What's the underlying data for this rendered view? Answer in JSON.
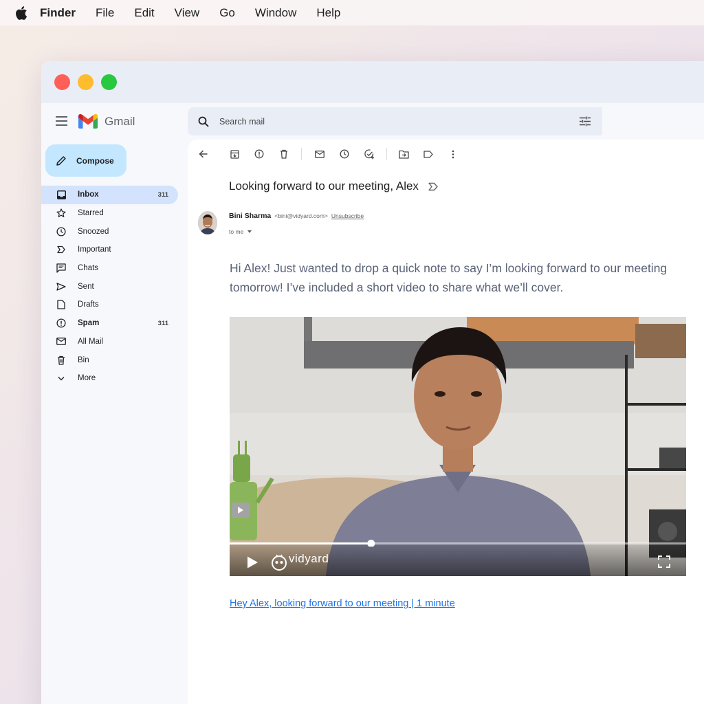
{
  "menubar": {
    "app": "Finder",
    "items": [
      "File",
      "Edit",
      "View",
      "Go",
      "Window",
      "Help"
    ]
  },
  "gmail": {
    "brand": "Gmail",
    "compose_label": "Compose",
    "search_placeholder": "Search mail",
    "nav": [
      {
        "label": "Inbox",
        "icon": "inbox-icon",
        "count": "311"
      },
      {
        "label": "Starred",
        "icon": "star-icon",
        "count": ""
      },
      {
        "label": "Snoozed",
        "icon": "clock-icon",
        "count": ""
      },
      {
        "label": "Important",
        "icon": "important-icon",
        "count": ""
      },
      {
        "label": "Chats",
        "icon": "chat-icon",
        "count": ""
      },
      {
        "label": "Sent",
        "icon": "send-icon",
        "count": ""
      },
      {
        "label": "Drafts",
        "icon": "draft-icon",
        "count": ""
      },
      {
        "label": "Spam",
        "icon": "spam-icon",
        "count": "311"
      },
      {
        "label": "All Mail",
        "icon": "mail-icon",
        "count": ""
      },
      {
        "label": "Bin",
        "icon": "trash-icon",
        "count": ""
      },
      {
        "label": "More",
        "icon": "chevron-down-icon",
        "count": ""
      }
    ]
  },
  "email": {
    "subject": "Looking forward to our meeting, Alex",
    "sender_name": "Bini Sharma",
    "sender_email": "<bini@vidyard.com>",
    "unsubscribe": "Unsubscribe",
    "to": "to me",
    "body": "Hi Alex! Just wanted to drop a quick note to say I’m looking forward to our meeting tomorrow! I’ve included a short video to share what we’ll cover.",
    "video_brand": "vidyard",
    "video_progress": 0.31,
    "video_link": "Hey Alex, looking forward to our meeting | 1 minute"
  },
  "colors": {
    "accent": "#1a73e8",
    "compose_bg": "#c2e7ff",
    "active_nav": "#d3e3fd"
  }
}
